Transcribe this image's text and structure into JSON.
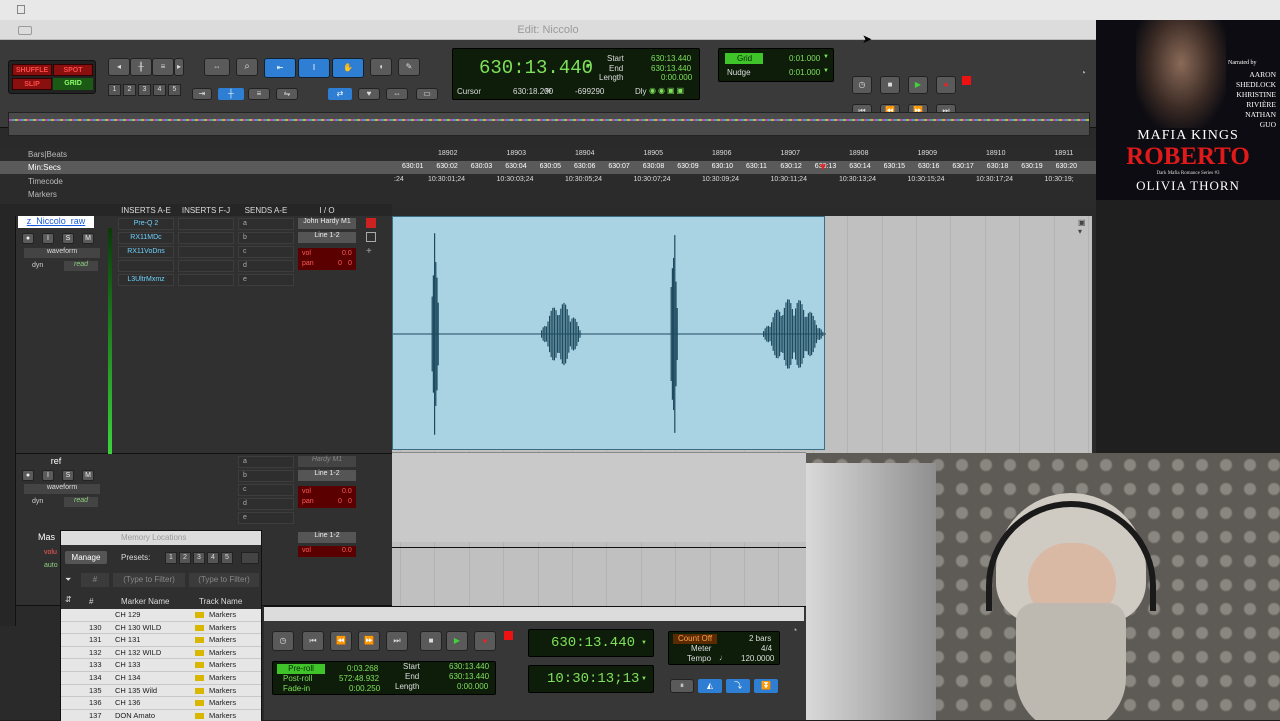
{
  "menubar": {
    "apple_icon": "apple-icon"
  },
  "window": {
    "title": "Edit: Niccolo"
  },
  "modes": {
    "shuffle": "SHUFFLE",
    "spot": "SPOT",
    "slip": "SLIP",
    "grid": "GRID"
  },
  "zoom_presets": [
    "1",
    "2",
    "3",
    "4",
    "5"
  ],
  "counter": {
    "main": "630:13.440",
    "start_label": "Start",
    "end_label": "End",
    "length_label": "Length",
    "start": "630:13.440",
    "end": "630:13.440",
    "length": "0:00.000",
    "cursor_label": "Cursor",
    "cursor": "630:18.200",
    "cursor_val2": "-699290",
    "dly": "Dly"
  },
  "grid": {
    "label": "Grid",
    "value": "0:01.000",
    "nudge_label": "Nudge",
    "nudge_value": "0:01.000"
  },
  "rulers": {
    "bars_label": "Bars|Beats",
    "minsecs_label": "Min:Secs",
    "timecode_label": "Timecode",
    "markers_label": "Markers",
    "bars": [
      "18902",
      "18903",
      "18904",
      "18905",
      "18906",
      "18907",
      "18908",
      "18909",
      "18910",
      "18911"
    ],
    "minsecs": [
      "630:01",
      "630:02",
      "630:03",
      "630:04",
      "630:05",
      "630:06",
      "630:07",
      "630:08",
      "630:09",
      "630:10",
      "630:11",
      "630:12",
      "630:13",
      "630:14",
      "630:15",
      "630:16",
      "630:17",
      "630:18",
      "630:19",
      "630:20"
    ],
    "timecode_first": ":24",
    "timecode": [
      "10:30:01;24",
      "10:30:03;24",
      "10:30:05;24",
      "10:30:07;24",
      "10:30:09;24",
      "10:30:11;24",
      "10:30:13;24",
      "10:30:15;24",
      "10:30:17;24",
      "10:30:19;"
    ]
  },
  "columns": {
    "inserts_ae": "INSERTS A-E",
    "inserts_fj": "INSERTS F-J",
    "sends_ae": "SENDS A-E",
    "io": "I / O"
  },
  "track1": {
    "name": "z_Niccolo_raw",
    "view": "waveform",
    "dyn": "dyn",
    "auto": "read",
    "inserts": [
      "Pre-Q 2",
      "RX11MDc",
      "RX11VoDns",
      "",
      "L3UltrMxmz"
    ],
    "sends": [
      "a",
      "b",
      "c",
      "d",
      "e"
    ],
    "input": "John Hardy M1",
    "output": "Line 1-2",
    "vol_label": "vol",
    "vol": "0.0",
    "pan_label": "pan",
    "pan": "0",
    "pan_dir": "0"
  },
  "track2": {
    "name": "ref",
    "view": "waveform",
    "dyn": "dyn",
    "auto": "read",
    "sends": [
      "a",
      "b",
      "c",
      "d",
      "e"
    ],
    "input": "Hardy M1",
    "output": "Line 1-2",
    "vol_label": "vol",
    "vol": "0.0",
    "pan_label": "pan",
    "pan": "0",
    "pan_dir": "0"
  },
  "track3": {
    "name": "Mas",
    "output": "Line 1-2",
    "vol_label": "vol",
    "vol": "0.0",
    "vol_cut": "volu",
    "auto_cut": "auto"
  },
  "msrm": {
    "rec": "●",
    "input": "I",
    "solo": "S",
    "mute": "M"
  },
  "memloc": {
    "title": "Memory Locations",
    "manage": "Manage",
    "presets_label": "Presets:",
    "presets": [
      "1",
      "2",
      "3",
      "4",
      "5"
    ],
    "filter_hash": "#",
    "filter1": "(Type to Filter)",
    "filter2": "(Type to Filter)",
    "col_num": "#",
    "col_name": "Marker Name",
    "col_track": "Track Name",
    "rows": [
      {
        "num": "",
        "name": "CH 129",
        "track": "Markers"
      },
      {
        "num": "130",
        "name": "CH 130 WILD",
        "track": "Markers"
      },
      {
        "num": "131",
        "name": "CH 131",
        "track": "Markers"
      },
      {
        "num": "132",
        "name": "CH 132 WILD",
        "track": "Markers"
      },
      {
        "num": "133",
        "name": "CH 133",
        "track": "Markers"
      },
      {
        "num": "134",
        "name": "CH 134",
        "track": "Markers"
      },
      {
        "num": "135",
        "name": "CH 135 Wild",
        "track": "Markers"
      },
      {
        "num": "136",
        "name": "CH 136",
        "track": "Markers"
      },
      {
        "num": "137",
        "name": "DON Amato",
        "track": "Markers"
      }
    ]
  },
  "transport": {
    "main": "630:13.440",
    "sub": "10:30:13;13",
    "preroll_label": "Pre-roll",
    "postroll_label": "Post-roll",
    "fadein_label": "Fade-in",
    "preroll": "0:03.268",
    "postroll": "572:48.932",
    "fadein": "0:00.250",
    "start_label": "Start",
    "end_label": "End",
    "length_label": "Length",
    "start": "630:13.440",
    "end": "630:13.440",
    "length": "0:00.000",
    "count_off": "Count Off",
    "meter_label": "Meter",
    "tempo_label": "Tempo",
    "bars": "2 bars",
    "meter": "4/4",
    "tempo": "120.0000"
  },
  "bookcover": {
    "narrated_by": "Narrated by",
    "narrators": [
      "AARON",
      "SHEDLOCK",
      "KHRISTINE",
      "RIVIÈRE",
      "NATHAN",
      "GUO"
    ],
    "series_title": "MAFIA KINGS",
    "book_title": "ROBERTO",
    "series_line": "Dark Mafia Romance Series #3",
    "author": "OLIVIA THORN"
  },
  "colors": {
    "waveform_bg": "#a9d2e2",
    "waveform": "#1e4b60",
    "counter_text": "#7fe05a",
    "track_name": "#6fd3ff"
  }
}
